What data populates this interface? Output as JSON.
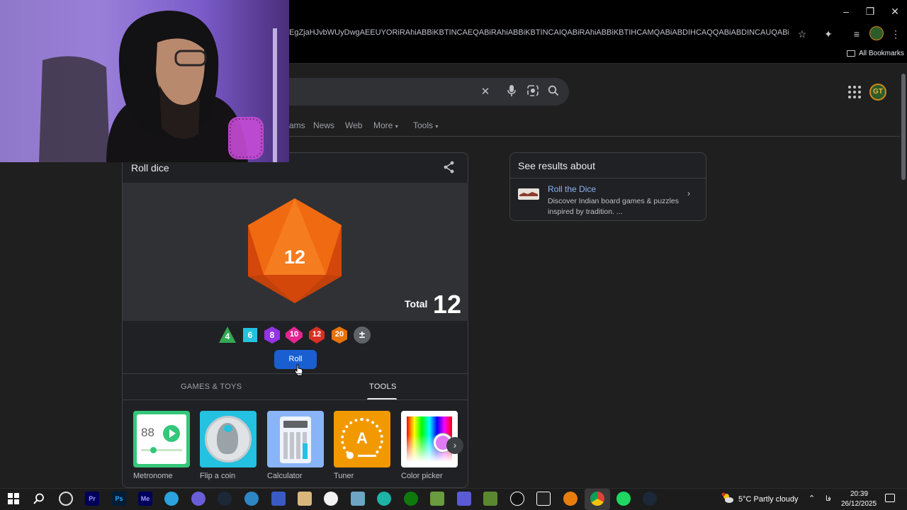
{
  "browser": {
    "url": "EgZjaHJvbWUyDwgAEEUYORiRAhiABBiKBTINCAEQABiRAhiABBiKBTINCAIQABiRAhiABBiKBTIHCAMQABiABDIHCAQQABiABDINCAUQABiRAhiABBiKBTIM...",
    "bookmarks_label": "All Bookmarks",
    "profile_initials": "GT"
  },
  "search": {
    "tabs": [
      "ams",
      "News",
      "Web",
      "More",
      "Tools"
    ]
  },
  "dice": {
    "title": "Roll dice",
    "result": "12",
    "total_label": "Total",
    "total_value": "12",
    "dice_options": [
      {
        "label": "4",
        "color": "#34a853",
        "shape": "triangle"
      },
      {
        "label": "6",
        "color": "#24c1e0",
        "shape": "square"
      },
      {
        "label": "8",
        "color": "#9334e6",
        "shape": "octagon"
      },
      {
        "label": "10",
        "color": "#e52592",
        "shape": "decagon"
      },
      {
        "label": "12",
        "color": "#d93025",
        "shape": "dodecagon"
      },
      {
        "label": "20",
        "color": "#e8710a",
        "shape": "icosagon"
      },
      {
        "label": "±",
        "color": "#5f6368",
        "shape": "circle"
      }
    ],
    "roll_button": "Roll",
    "tabs": [
      "GAMES & TOYS",
      "TOOLS"
    ],
    "active_tab": "TOOLS",
    "tools": [
      {
        "label": "Metronome",
        "display": "88"
      },
      {
        "label": "Flip a coin"
      },
      {
        "label": "Calculator"
      },
      {
        "label": "Tuner",
        "display": "A"
      },
      {
        "label": "Color picker"
      }
    ]
  },
  "side_panel": {
    "title": "See results about",
    "link": "Roll the Dice",
    "description": "Discover Indian board games & puzzles inspired by tradition. ..."
  },
  "taskbar": {
    "apps": [
      "Pr",
      "Ps",
      "Me"
    ],
    "weather": "5°C  Partly cloudy",
    "language": "فا",
    "time": "20:39",
    "date": "26/12/2025"
  },
  "colors": {
    "page_bg": "#1f1f1f",
    "die_main": "#e8510a",
    "roll_button": "#1a5fd1",
    "link": "#8ab4f8"
  }
}
